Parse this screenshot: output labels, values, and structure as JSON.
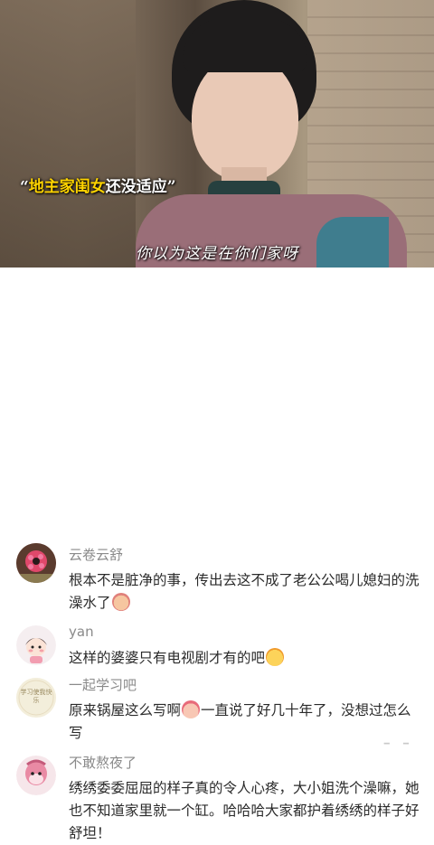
{
  "hero": {
    "tag_open": "“",
    "tag_highlight": "地主家闺女",
    "tag_rest": "还没适应",
    "tag_close": "”",
    "subtitle": "你以为这是在你们家呀"
  },
  "comments": [
    {
      "username": "云卷云舒",
      "text": "根本不是脏净的事，传出去这不成了老公公喝儿媳妇的洗澡水了",
      "emoji": "embarrassed-face"
    },
    {
      "username": "yan",
      "text": "这样的婆婆只有电视剧才有的吧",
      "emoji": "grinning-face"
    },
    {
      "username": "一起学习吧",
      "text_before": "原来锅屋这么写啊",
      "text_after": "一直说了好几十年了，没想过怎么写",
      "emoji": "laughing-face",
      "avatar_text": "学习使我快乐"
    },
    {
      "username": "不敢熬夜了",
      "text": "绣绣委委屈屈的样子真的令人心疼，大小姐洗个澡嘛，她也不知道家里就一个缸。哈哈哈大家都护着绣绣的样子好舒坦！"
    }
  ],
  "colors": {
    "username": "#8a8a8a",
    "text": "#2a2a2a",
    "tag_highlight": "#ffd400"
  }
}
